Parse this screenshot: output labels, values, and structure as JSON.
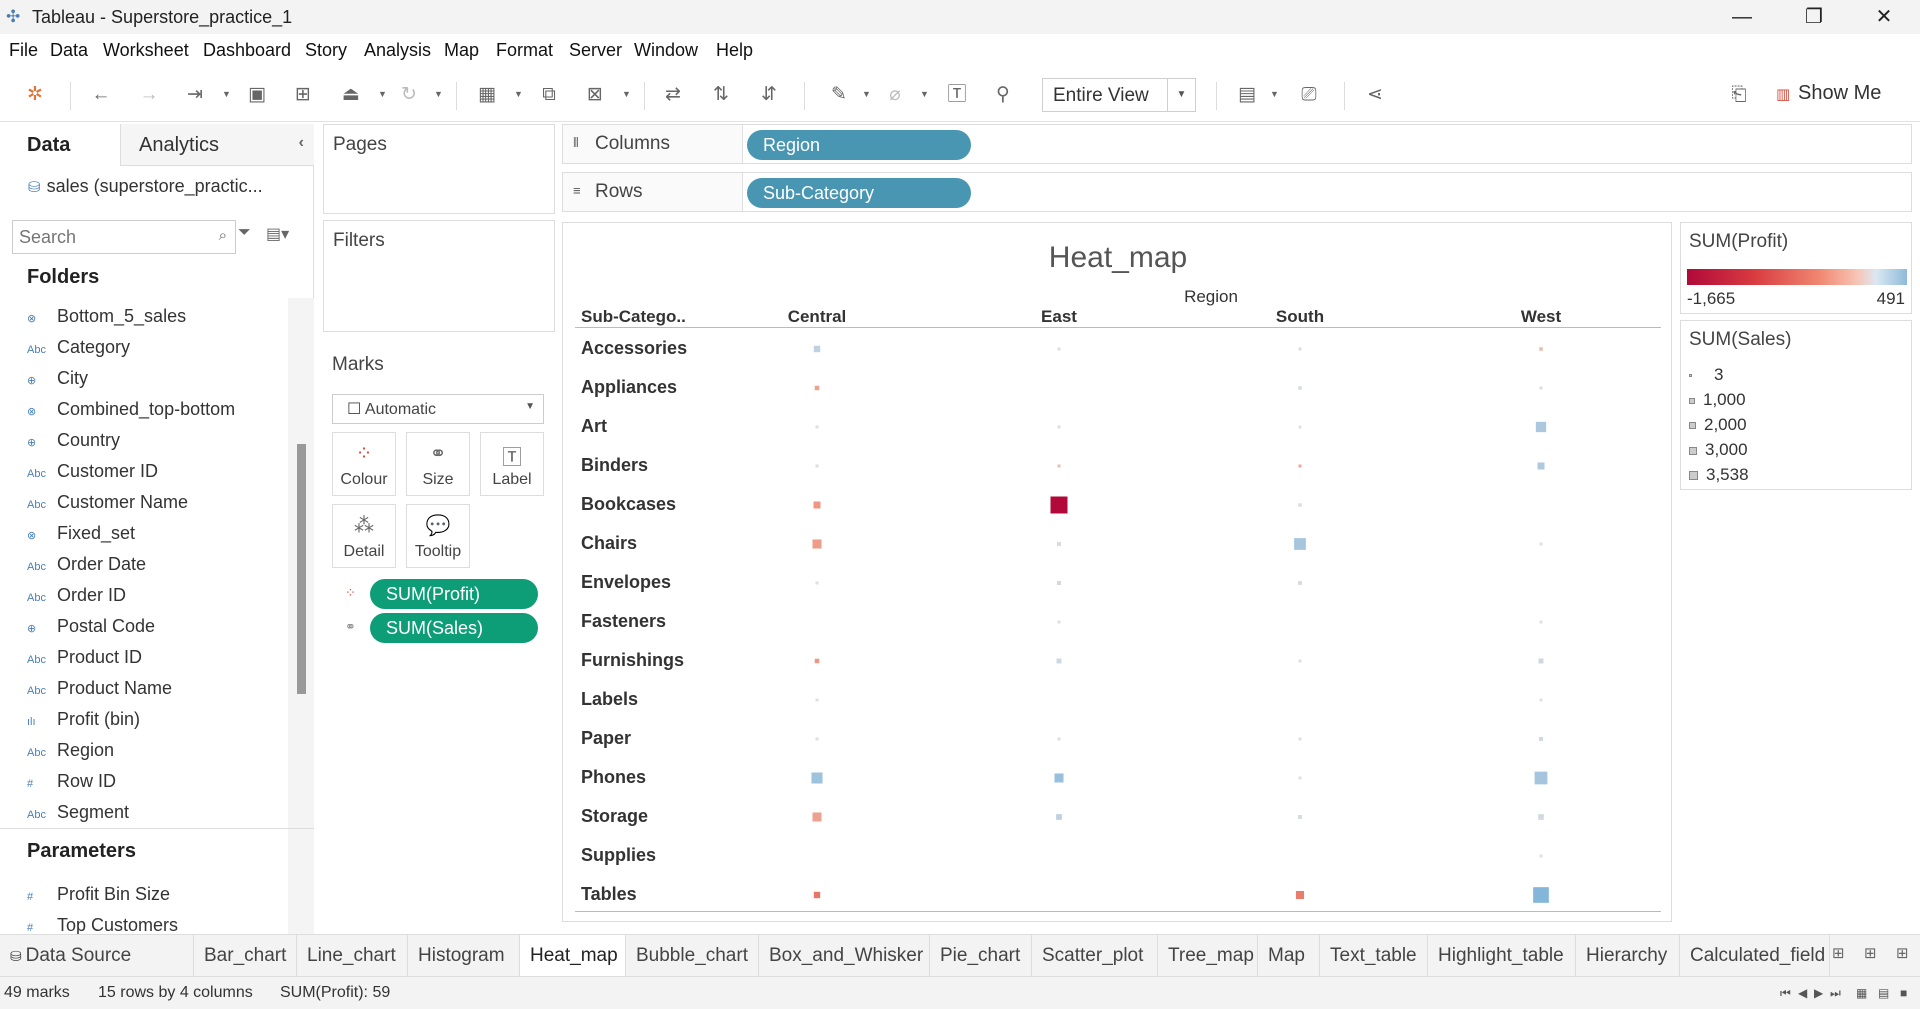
{
  "window": {
    "title": "Tableau - Superstore_practice_1",
    "minimize": "—",
    "restore": "❐",
    "close": "✕"
  },
  "menu": [
    "File",
    "Data",
    "Worksheet",
    "Dashboard",
    "Story",
    "Analysis",
    "Map",
    "Format",
    "Server",
    "Window",
    "Help"
  ],
  "toolbar": {
    "fit": "Entire View",
    "show_me": "Show Me"
  },
  "data_pane": {
    "tab_data": "Data",
    "tab_analytics": "Analytics",
    "data_source": "sales (superstore_practic...",
    "search_placeholder": "Search",
    "folders_title": "Folders",
    "fields": [
      {
        "icon": "set-icon",
        "name": "Bottom_5_sales"
      },
      {
        "icon": "abc",
        "name": "Category"
      },
      {
        "icon": "globe-icon",
        "name": "City"
      },
      {
        "icon": "set-icon",
        "name": "Combined_top-bottom"
      },
      {
        "icon": "globe-icon",
        "name": "Country"
      },
      {
        "icon": "abc",
        "name": "Customer ID"
      },
      {
        "icon": "abc",
        "name": "Customer Name"
      },
      {
        "icon": "set-icon",
        "name": "Fixed_set"
      },
      {
        "icon": "abc",
        "name": "Order Date"
      },
      {
        "icon": "abc",
        "name": "Order ID"
      },
      {
        "icon": "globe-icon",
        "name": "Postal Code"
      },
      {
        "icon": "abc",
        "name": "Product ID"
      },
      {
        "icon": "abc",
        "name": "Product Name"
      },
      {
        "icon": "bin-icon",
        "name": "Profit (bin)"
      },
      {
        "icon": "abc",
        "name": "Region"
      },
      {
        "icon": "hash",
        "name": "Row ID"
      },
      {
        "icon": "abc",
        "name": "Segment"
      }
    ],
    "params_title": "Parameters",
    "params": [
      {
        "icon": "hash",
        "name": "Profit Bin Size"
      },
      {
        "icon": "hash",
        "name": "Top Customers"
      }
    ]
  },
  "cards": {
    "pages": "Pages",
    "filters": "Filters",
    "marks": "Marks",
    "mark_type": "Automatic",
    "mark_buttons": [
      "Colour",
      "Size",
      "Label",
      "Detail",
      "Tooltip"
    ],
    "mark_pills": [
      "SUM(Profit)",
      "SUM(Sales)"
    ]
  },
  "shelves": {
    "columns_label": "Columns",
    "columns_pill": "Region",
    "rows_label": "Rows",
    "rows_pill": "Sub-Category"
  },
  "chart_data": {
    "type": "heatmap",
    "title": "Heat_map",
    "column_field": "Region",
    "row_field": "Sub-Catego..",
    "columns": [
      "Central",
      "East",
      "South",
      "West"
    ],
    "rows": [
      "Accessories",
      "Appliances",
      "Art",
      "Binders",
      "Bookcases",
      "Chairs",
      "Envelopes",
      "Fasteners",
      "Furnishings",
      "Labels",
      "Paper",
      "Phones",
      "Storage",
      "Supplies",
      "Tables"
    ],
    "color_measure": "SUM(Profit)",
    "size_measure": "SUM(Sales)",
    "profit_range": [
      -1665,
      491
    ],
    "sales_range": [
      3,
      3538
    ],
    "cells": [
      {
        "row": "Accessories",
        "col": "Central",
        "sales": 500,
        "profit": 120
      },
      {
        "row": "Accessories",
        "col": "East",
        "sales": 60,
        "profit": 10
      },
      {
        "row": "Accessories",
        "col": "South",
        "sales": 60,
        "profit": 10
      },
      {
        "row": "Accessories",
        "col": "West",
        "sales": 150,
        "profit": -40
      },
      {
        "row": "Appliances",
        "col": "Central",
        "sales": 250,
        "profit": -200
      },
      {
        "row": "Appliances",
        "col": "South",
        "sales": 150,
        "profit": 20
      },
      {
        "row": "Appliances",
        "col": "West",
        "sales": 60,
        "profit": 10
      },
      {
        "row": "Art",
        "col": "Central",
        "sales": 40,
        "profit": 5
      },
      {
        "row": "Art",
        "col": "East",
        "sales": 40,
        "profit": 5
      },
      {
        "row": "Art",
        "col": "South",
        "sales": 15,
        "profit": 2
      },
      {
        "row": "Art",
        "col": "West",
        "sales": 1300,
        "profit": 220
      },
      {
        "row": "Binders",
        "col": "Central",
        "sales": 60,
        "profit": 10
      },
      {
        "row": "Binders",
        "col": "East",
        "sales": 40,
        "profit": -30
      },
      {
        "row": "Binders",
        "col": "South",
        "sales": 80,
        "profit": -150
      },
      {
        "row": "Binders",
        "col": "West",
        "sales": 600,
        "profit": 200
      },
      {
        "row": "Bookcases",
        "col": "Central",
        "sales": 600,
        "profit": -300
      },
      {
        "row": "Bookcases",
        "col": "East",
        "sales": 3538,
        "profit": -1665
      },
      {
        "row": "Bookcases",
        "col": "South",
        "sales": 150,
        "profit": 10
      },
      {
        "row": "Chairs",
        "col": "Central",
        "sales": 1000,
        "profit": -250
      },
      {
        "row": "Chairs",
        "col": "East",
        "sales": 200,
        "profit": 20
      },
      {
        "row": "Chairs",
        "col": "South",
        "sales": 1700,
        "profit": 250
      },
      {
        "row": "Chairs",
        "col": "West",
        "sales": 40,
        "profit": 5
      },
      {
        "row": "Envelopes",
        "col": "Central",
        "sales": 40,
        "profit": 5
      },
      {
        "row": "Envelopes",
        "col": "East",
        "sales": 200,
        "profit": 40
      },
      {
        "row": "Envelopes",
        "col": "South",
        "sales": 180,
        "profit": 30
      },
      {
        "row": "Fasteners",
        "col": "East",
        "sales": 30,
        "profit": 5
      },
      {
        "row": "Fasteners",
        "col": "West",
        "sales": 15,
        "profit": 3
      },
      {
        "row": "Furnishings",
        "col": "Central",
        "sales": 250,
        "profit": -300
      },
      {
        "row": "Furnishings",
        "col": "East",
        "sales": 300,
        "profit": 60
      },
      {
        "row": "Furnishings",
        "col": "South",
        "sales": 40,
        "profit": 5
      },
      {
        "row": "Furnishings",
        "col": "West",
        "sales": 300,
        "profit": 60
      },
      {
        "row": "Labels",
        "col": "Central",
        "sales": 30,
        "profit": 5
      },
      {
        "row": "Labels",
        "col": "West",
        "sales": 15,
        "profit": 3
      },
      {
        "row": "Paper",
        "col": "Central",
        "sales": 40,
        "profit": 5
      },
      {
        "row": "Paper",
        "col": "East",
        "sales": 80,
        "profit": 10
      },
      {
        "row": "Paper",
        "col": "South",
        "sales": 40,
        "profit": 5
      },
      {
        "row": "Paper",
        "col": "West",
        "sales": 200,
        "profit": 40
      },
      {
        "row": "Phones",
        "col": "Central",
        "sales": 1500,
        "profit": 300
      },
      {
        "row": "Phones",
        "col": "East",
        "sales": 1000,
        "profit": 350
      },
      {
        "row": "Phones",
        "col": "South",
        "sales": 15,
        "profit": 3
      },
      {
        "row": "Phones",
        "col": "West",
        "sales": 2000,
        "profit": 260
      },
      {
        "row": "Storage",
        "col": "Central",
        "sales": 1000,
        "profit": -200
      },
      {
        "row": "Storage",
        "col": "East",
        "sales": 400,
        "profit": 120
      },
      {
        "row": "Storage",
        "col": "South",
        "sales": 200,
        "profit": 20
      },
      {
        "row": "Storage",
        "col": "West",
        "sales": 400,
        "profit": 40
      },
      {
        "row": "Supplies",
        "col": "West",
        "sales": 40,
        "profit": 5
      },
      {
        "row": "Tables",
        "col": "Central",
        "sales": 500,
        "profit": -600
      },
      {
        "row": "Tables",
        "col": "South",
        "sales": 800,
        "profit": -550
      },
      {
        "row": "Tables",
        "col": "West",
        "sales": 3000,
        "profit": 491
      }
    ]
  },
  "legends": {
    "profit_title": "SUM(Profit)",
    "profit_min": "-1,665",
    "profit_max": "491",
    "sales_title": "SUM(Sales)",
    "sales_items": [
      "3",
      "1,000",
      "2,000",
      "3,000",
      "3,538"
    ]
  },
  "sheet_tabs": [
    "Data Source",
    "Bar_chart",
    "Line_chart",
    "Histogram",
    "Heat_map",
    "Bubble_chart",
    "Box_and_Whisker",
    "Pie_chart",
    "Scatter_plot",
    "Tree_map",
    "Map",
    "Text_table",
    "Highlight_table",
    "Hierarchy",
    "Calculated_field"
  ],
  "active_tab": "Heat_map",
  "status": {
    "marks": "49 marks",
    "dims": "15 rows by 4 columns",
    "sum": "SUM(Profit): 59"
  },
  "colors": {
    "negative": "#b0093a",
    "positive": "#8ebbd9",
    "pill_green": "#0e9e77",
    "pill_blue": "#4996b2"
  }
}
